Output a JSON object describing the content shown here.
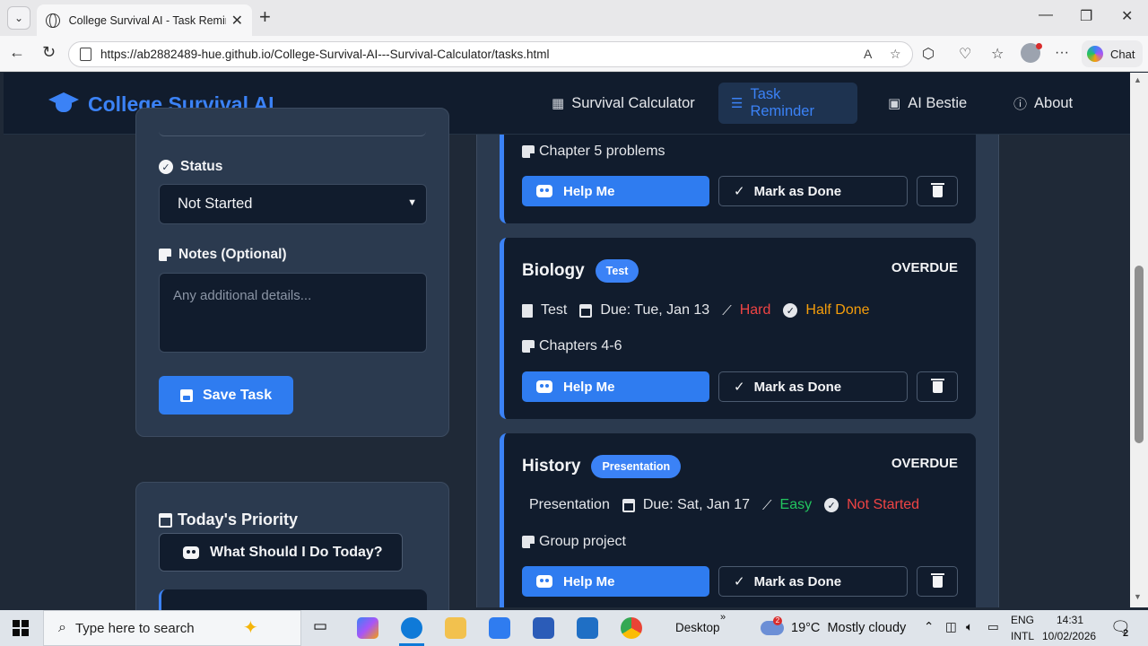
{
  "browser": {
    "tab_title": "College Survival AI - Task Reminder",
    "url": "https://ab2882489-hue.github.io/College-Survival-AI---Survival-Calculator/tasks.html",
    "chat_label": "Chat"
  },
  "nav": {
    "brand": "College Survival AI",
    "links": [
      {
        "label": "Survival Calculator",
        "icon": "calculator-icon"
      },
      {
        "label": "Task Reminder",
        "icon": "list-icon",
        "active": true
      },
      {
        "label": "AI Bestie",
        "icon": "robot-icon"
      },
      {
        "label": "About",
        "icon": "info-icon"
      }
    ]
  },
  "form": {
    "status_label": "Status",
    "status_value": "Not Started",
    "notes_label": "Notes (Optional)",
    "notes_placeholder": "Any additional details...",
    "save_label": "Save Task"
  },
  "priority": {
    "title": "Today's Priority",
    "button_label": "What Should I Do Today?"
  },
  "tasks": [
    {
      "note": "Chapter 5 problems",
      "help_label": "Help Me",
      "done_label": "Mark as Done"
    },
    {
      "subject": "Biology",
      "type_badge": "Test",
      "overdue": "OVERDUE",
      "type": "Test",
      "due": "Due: Tue, Jan 13",
      "difficulty": "Hard",
      "status": "Half Done",
      "note": "Chapters 4-6",
      "help_label": "Help Me",
      "done_label": "Mark as Done"
    },
    {
      "subject": "History",
      "type_badge": "Presentation",
      "overdue": "OVERDUE",
      "type": "Presentation",
      "due": "Due: Sat, Jan 17",
      "difficulty": "Easy",
      "status": "Not Started",
      "note": "Group project",
      "help_label": "Help Me",
      "done_label": "Mark as Done"
    }
  ],
  "taskbar": {
    "search_placeholder": "Type here to search",
    "desktop_label": "Desktop",
    "weather": "19°C  Mostly cloudy",
    "weather_badge": "2",
    "lang1": "ENG",
    "lang2": "INTL",
    "time": "14:31",
    "date": "10/02/2026",
    "notif_count": "2"
  },
  "colors": {
    "accent": "#3b82f6",
    "page_bg": "#1f2937",
    "card_bg": "#111c2d",
    "panel_bg": "#2b3a4f",
    "hard": "#ef4444",
    "half": "#f59e0b",
    "easy": "#22c55e"
  }
}
